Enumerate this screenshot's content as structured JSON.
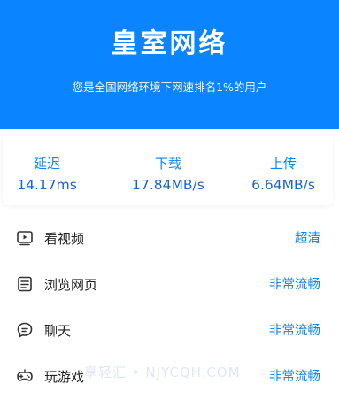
{
  "hero": {
    "title": "皇室网络",
    "subtitle": "您是全国网络环境下网速排名1%的用户",
    "background_color": "#0a84ff"
  },
  "stats": [
    {
      "label": "延迟",
      "value": "14.17ms"
    },
    {
      "label": "下载",
      "value": "17.84MB/s"
    },
    {
      "label": "上传",
      "value": "6.64MB/s"
    }
  ],
  "activities": [
    {
      "icon": "video-icon",
      "label": "看视频",
      "status": "超清"
    },
    {
      "icon": "browser-icon",
      "label": "浏览网页",
      "status": "非常流畅"
    },
    {
      "icon": "chat-icon",
      "label": "聊天",
      "status": "非常流畅"
    },
    {
      "icon": "gamepad-icon",
      "label": "玩游戏",
      "status": "非常流畅"
    }
  ],
  "watermark": "享轻汇 • NJYCQH.COM",
  "accent_color": "#0a84ff"
}
